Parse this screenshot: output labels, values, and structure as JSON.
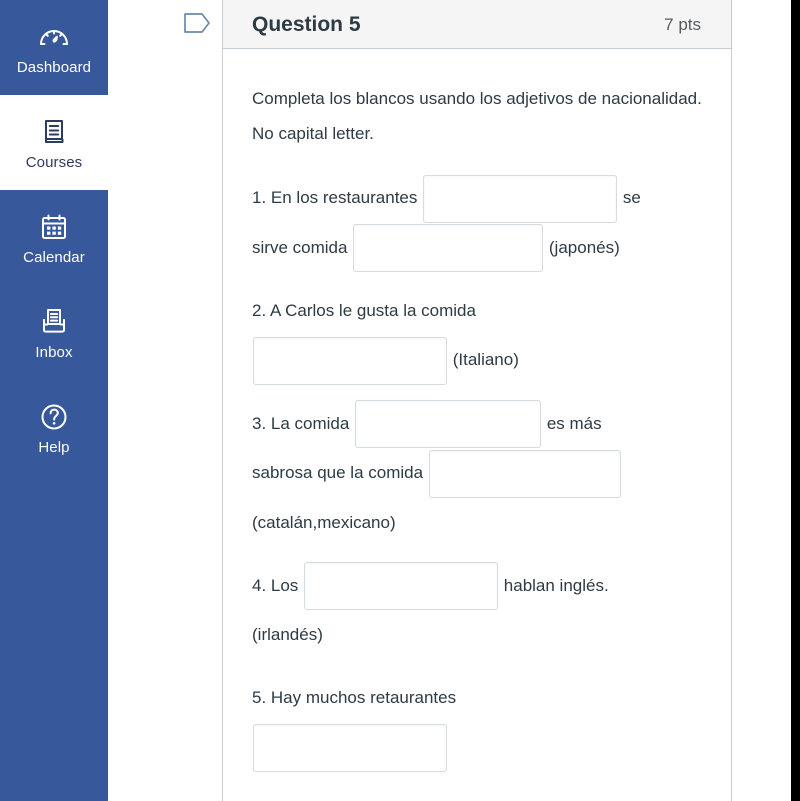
{
  "sidebar": {
    "background_color": "#37589b",
    "active_background_color": "#ffffff",
    "items": [
      {
        "label": "Dashboard",
        "icon": "dashboard-gauge-icon",
        "active": false
      },
      {
        "label": "Courses",
        "icon": "courses-book-icon",
        "active": true
      },
      {
        "label": "Calendar",
        "icon": "calendar-icon",
        "active": false
      },
      {
        "label": "Inbox",
        "icon": "inbox-tray-icon",
        "active": false
      },
      {
        "label": "Help",
        "icon": "help-question-icon",
        "active": false
      }
    ]
  },
  "question": {
    "flag_icon": "flag-bookmark-icon",
    "title": "Question 5",
    "points": "7 pts",
    "prompt": "Completa los blancos usando los adjetivos de nacionalidad. No capital letter.",
    "items": [
      {
        "number": "1.",
        "segments": [
          {
            "type": "text",
            "value": "1. En los restaurantes "
          },
          {
            "type": "blank",
            "value": "",
            "width": "w194"
          },
          {
            "type": "text",
            "value": " se"
          }
        ],
        "segments2": [
          {
            "type": "text",
            "value": "sirve comida "
          },
          {
            "type": "blank",
            "value": "",
            "width": "w190"
          },
          {
            "type": "text",
            "value": "(japonés)"
          }
        ]
      },
      {
        "number": "2.",
        "segments": [
          {
            "type": "text",
            "value": "2. A Carlos le gusta la comida"
          }
        ],
        "segments2": [
          {
            "type": "blank",
            "value": "",
            "width": "w194"
          },
          {
            "type": "text",
            "value": "(Italiano)"
          }
        ]
      },
      {
        "number": "3.",
        "segments": [
          {
            "type": "text",
            "value": "3. La comida "
          },
          {
            "type": "blank",
            "value": "",
            "width": "w186"
          },
          {
            "type": "text",
            "value": " es más"
          }
        ],
        "segments2": [
          {
            "type": "text",
            "value": "sabrosa que la comida "
          },
          {
            "type": "blank",
            "value": "",
            "width": "w192"
          }
        ],
        "segments3": [
          {
            "type": "text",
            "value": "(catalán,mexicano)"
          }
        ]
      },
      {
        "number": "4.",
        "segments": [
          {
            "type": "text",
            "value": "4. Los "
          },
          {
            "type": "blank",
            "value": "",
            "width": "w194"
          },
          {
            "type": "text",
            "value": " hablan inglés."
          }
        ],
        "segments2": [
          {
            "type": "text",
            "value": "(irlandés)"
          }
        ]
      },
      {
        "number": "5.",
        "segments": [
          {
            "type": "text",
            "value": "5. Hay muchos retaurantes"
          }
        ],
        "segments2": [
          {
            "type": "blank",
            "value": "",
            "width": "w194"
          }
        ]
      }
    ],
    "text": {
      "i1_a": "1. En los restaurantes",
      "i1_b": "se",
      "i1_c": "sirve comida",
      "i1_d": "(japonés)",
      "i2_a": "2. A Carlos le gusta la comida",
      "i2_b": "(Italiano)",
      "i3_a": "3. La comida",
      "i3_b": "es más",
      "i3_c": "sabrosa que la comida",
      "i3_d": "(catalán,mexicano)",
      "i4_a": "4. Los",
      "i4_b": "hablan inglés.",
      "i4_c": "(irlandés)",
      "i5_a": "5. Hay muchos retaurantes"
    }
  }
}
